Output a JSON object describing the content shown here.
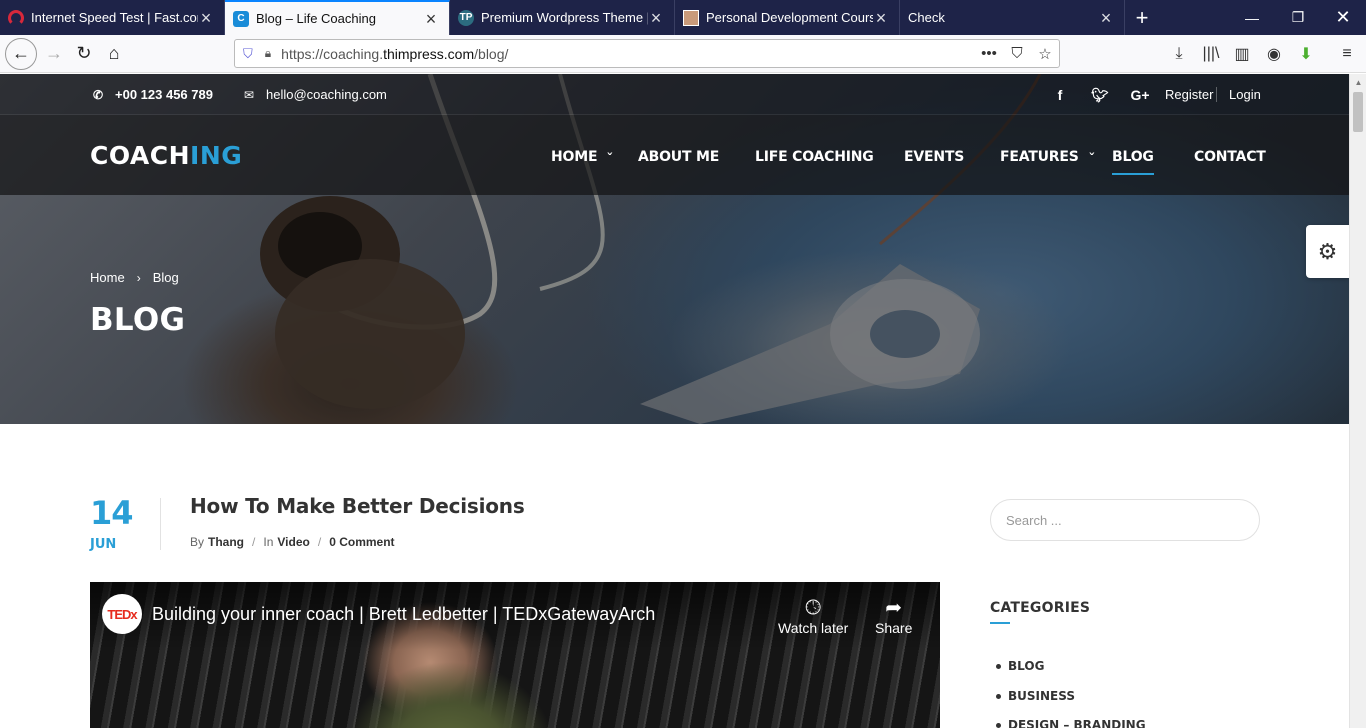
{
  "browser": {
    "tabs": [
      {
        "title": "Internet Speed Test | Fast.com",
        "icon": "fast-com-icon",
        "active": false
      },
      {
        "title": "Blog – Life Coaching",
        "icon": "coaching-c-icon",
        "active": true
      },
      {
        "title": "Premium Wordpress Theme | D",
        "icon": "thimpress-icon",
        "active": false
      },
      {
        "title": "Personal Development Course",
        "icon": "person-photo-icon",
        "active": false
      },
      {
        "title": "Check",
        "icon": "",
        "active": false
      }
    ],
    "url_prefix": "https://coaching.",
    "url_domain": "thimpress.com",
    "url_path": "/blog/"
  },
  "topbar": {
    "phone": "+00 123 456 789",
    "email": "hello@coaching.com",
    "register": "Register",
    "login": "Login"
  },
  "logo": {
    "part1": "COACH",
    "part2": "ING"
  },
  "nav": {
    "home": "HOME",
    "about": "ABOUT ME",
    "life_coaching": "LIFE COACHING",
    "events": "EVENTS",
    "features": "FEATURES",
    "blog": "BLOG",
    "contact": "CONTACT"
  },
  "hero": {
    "breadcrumb_home": "Home",
    "breadcrumb_sep": "›",
    "breadcrumb_current": "Blog",
    "title": "BLOG"
  },
  "post": {
    "day": "14",
    "month": "JUN",
    "title": "How To Make Better Decisions",
    "by_label": "By",
    "author": "Thang",
    "in_label": "In",
    "category": "Video",
    "comments": "0 Comment"
  },
  "video": {
    "ted_label": "TEDx",
    "title": "Building your inner coach | Brett Ledbetter | TEDxGatewayArch",
    "watch_later": "Watch later",
    "share": "Share"
  },
  "sidebar": {
    "search_placeholder": "Search ...",
    "categories_title": "CATEGORIES",
    "categories": [
      "BLOG",
      "BUSINESS",
      "DESIGN – BRANDING"
    ]
  },
  "colors": {
    "accent": "#2a9fd6",
    "tabbar": "#1e2348"
  }
}
